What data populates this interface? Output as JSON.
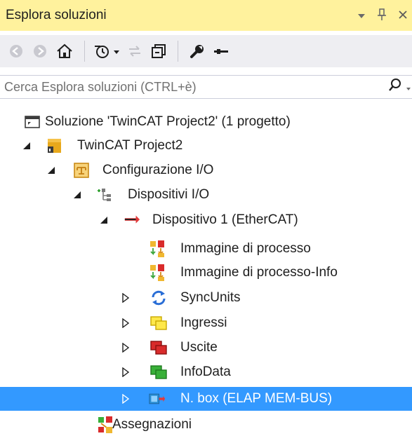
{
  "window": {
    "title": "Esplora soluzioni",
    "controls": {
      "dropdown": "▾",
      "pin": "ᵽ",
      "close": "✕"
    }
  },
  "toolbar": {
    "buttons": [
      {
        "icon": "back-icon"
      },
      {
        "icon": "forward-icon"
      },
      {
        "icon": "home-icon"
      },
      {
        "icon": "pending-changes-filter-icon"
      },
      {
        "icon": "sync-icon"
      },
      {
        "icon": "collapse-all-icon"
      },
      {
        "icon": "properties-wrench-icon"
      },
      {
        "icon": "preview-icon"
      }
    ]
  },
  "search": {
    "placeholder": "Cerca Esplora soluzioni (CTRL+è)",
    "icon": "search-icon"
  },
  "tree": {
    "solution": "Soluzione 'TwinCAT Project2'  (1 progetto)",
    "project": "TwinCAT Project2",
    "io_config": "Configurazione I/O",
    "devices": "Dispositivi I/O",
    "device1": "Dispositivo 1 (EtherCAT)",
    "process_image": "Immagine di processo",
    "process_image_info": "Immagine di processo-Info",
    "sync_units": "SyncUnits",
    "inputs": "Ingressi",
    "outputs": "Uscite",
    "info_data": "InfoData",
    "box": "N. box (ELAP MEM-BUS)",
    "mappings": "Assegnazioni"
  },
  "colors": {
    "title_bg": "#fff29d",
    "toolbar_bg": "#eeeef2",
    "selection": "#3399ff"
  }
}
